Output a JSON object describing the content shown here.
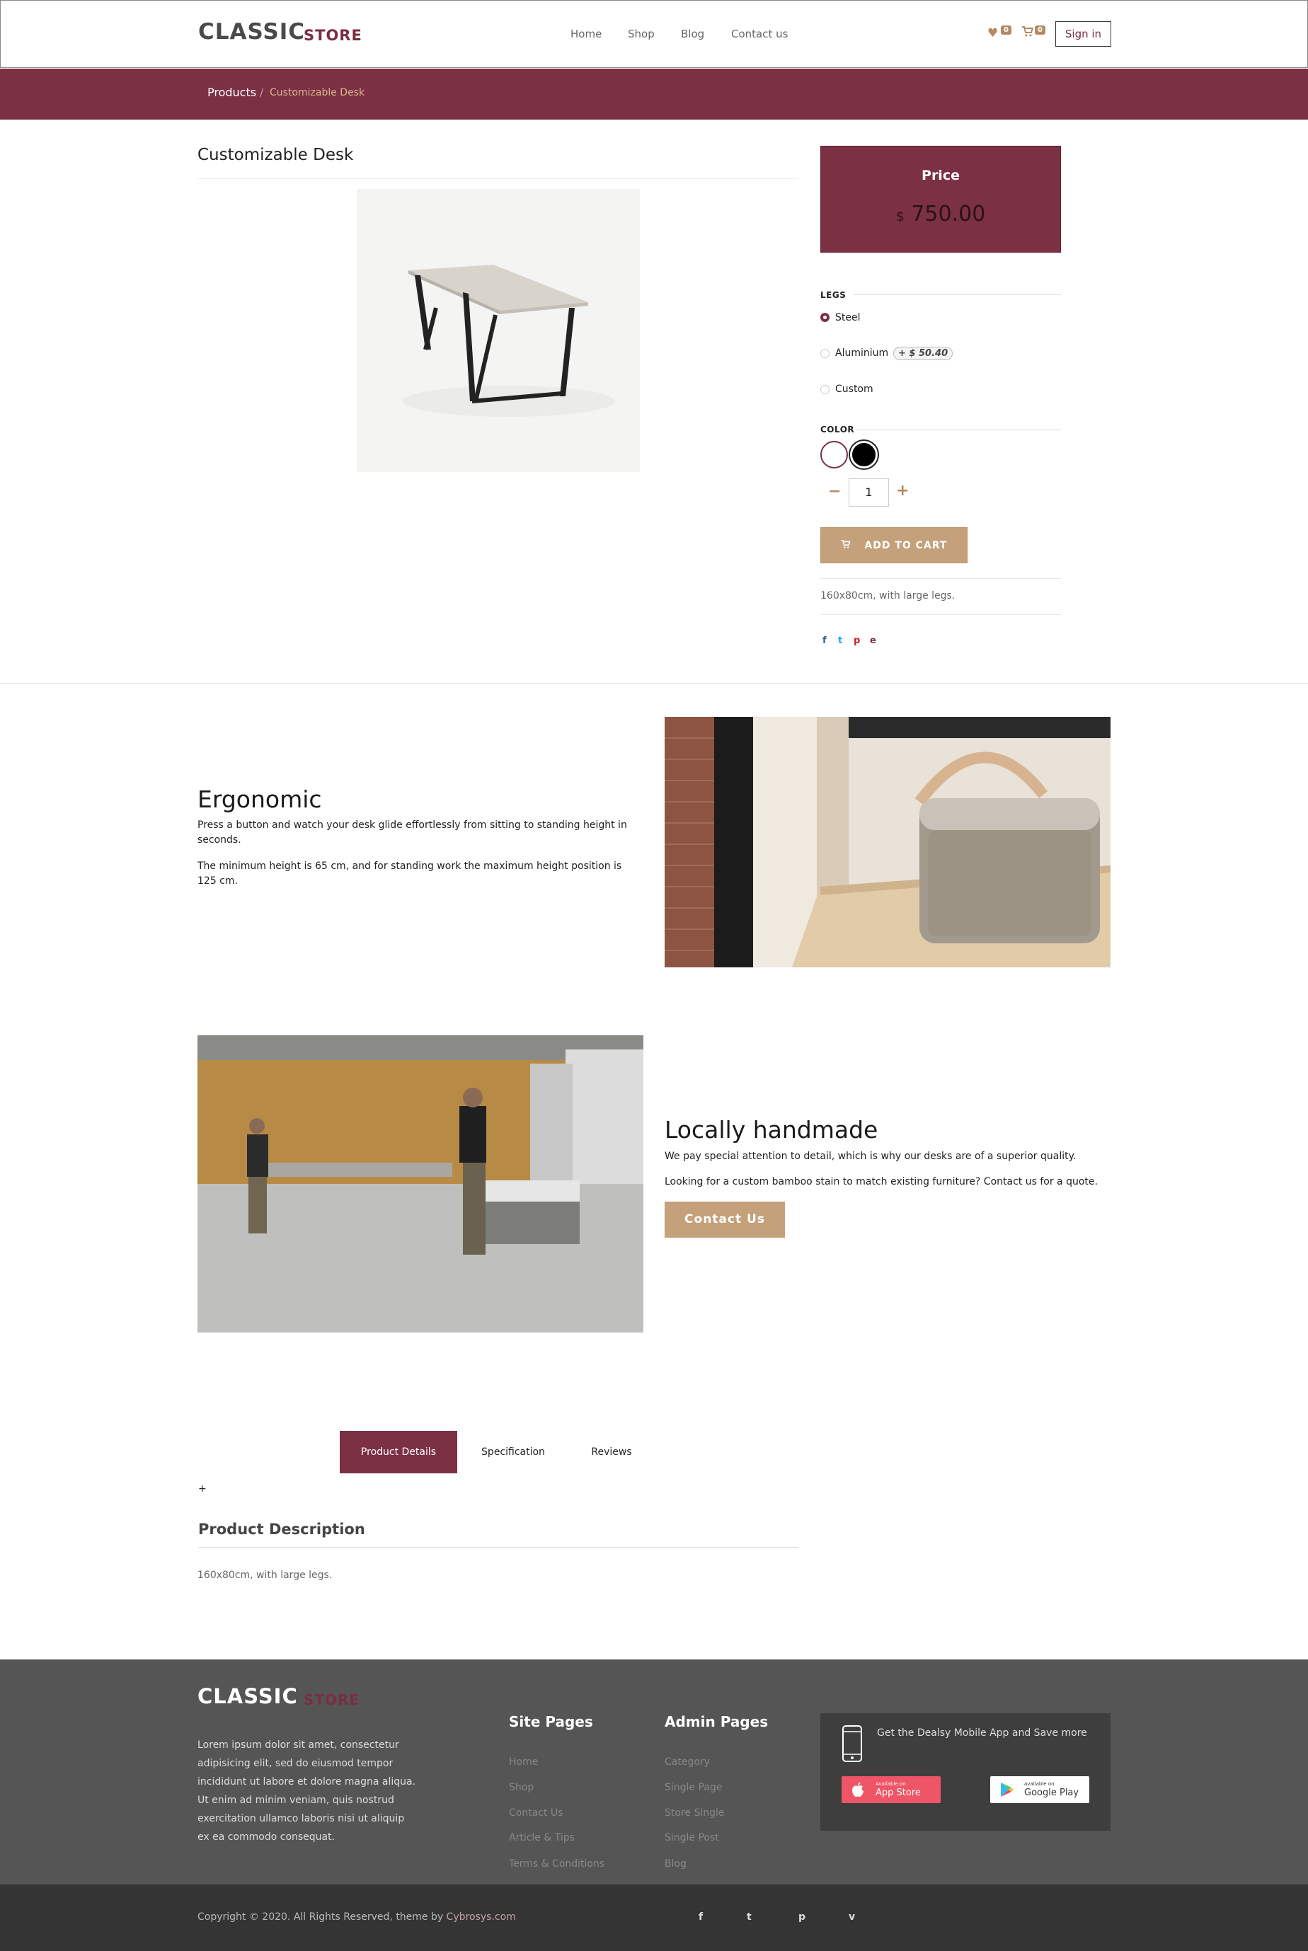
{
  "header": {
    "logo_main": "CLASSIC",
    "logo_sub": "STORE",
    "nav": [
      "Home",
      "Shop",
      "Blog",
      "Contact us"
    ],
    "wishlist_count": "0",
    "cart_count": "0",
    "signin_label": "Sign in"
  },
  "breadcrumb": {
    "parent": "Products",
    "separator": "/",
    "current": "Customizable Desk"
  },
  "product": {
    "title": "Customizable Desk",
    "price_label": "Price",
    "currency": "$",
    "price": "750.00",
    "attributes": {
      "legs_label": "LEGS",
      "legs_options": [
        {
          "label": "Steel",
          "checked": true
        },
        {
          "label": "Aluminium",
          "extra": "+ $ 50.40"
        },
        {
          "label": "Custom"
        }
      ],
      "color_label": "COLOR",
      "colors": [
        "#ffffff",
        "#000000"
      ]
    },
    "quantity": "1",
    "add_to_cart": "ADD TO CART",
    "short_description": "160x80cm, with large legs.",
    "share": [
      "f",
      "t",
      "p",
      "e"
    ]
  },
  "features": {
    "ergonomic": {
      "title": "Ergonomic",
      "p1": "Press a button and watch your desk glide effortlessly from sitting to standing height in seconds.",
      "p2": "The minimum height is 65 cm, and for standing work the maximum height position is 125 cm."
    },
    "handmade": {
      "title": "Locally handmade",
      "p1": "We pay special attention to detail, which is why our desks are of a superior quality.",
      "p2": "Looking for a custom bamboo stain to match existing furniture? Contact us for a quote.",
      "button": "Contact Us"
    }
  },
  "tabs": {
    "items": [
      "Product Details",
      "Specification",
      "Reviews"
    ],
    "active": 0,
    "plus": "+",
    "description_title": "Product Description",
    "description_text": "160x80cm, with large legs."
  },
  "footer": {
    "logo_main": "CLASSIC",
    "logo_sub": "STORE",
    "about": "Lorem ipsum dolor sit amet, consectetur adipisicing elit, sed do eiusmod tempor incididunt ut labore et dolore magna aliqua. Ut enim ad minim veniam, quis nostrud exercitation ullamco laboris nisi ut aliquip ex ea commodo consequat.",
    "site_pages_title": "Site Pages",
    "site_pages": [
      "Home",
      "Shop",
      "Contact Us",
      "Article & Tips",
      "Terms & Conditions"
    ],
    "admin_pages_title": "Admin Pages",
    "admin_pages": [
      "Category",
      "Single Page",
      "Store Single",
      "Single Post",
      "Blog"
    ],
    "app_text": "Get the Dealsy Mobile App and Save more",
    "ios_small": "Available on",
    "ios_big": "App Store",
    "gp_small": "available on",
    "gp_big": "Google Play",
    "copyright": "Copyright © 2020. All Rights Reserved, theme by ",
    "copyright_link": "Cybrosys.com",
    "social": [
      "f",
      "t",
      "p",
      "v"
    ]
  },
  "colors": {
    "brand": "#7b3044",
    "accent": "#c4a17b",
    "footer_bg": "#555555",
    "bottom_bg": "#343434"
  }
}
